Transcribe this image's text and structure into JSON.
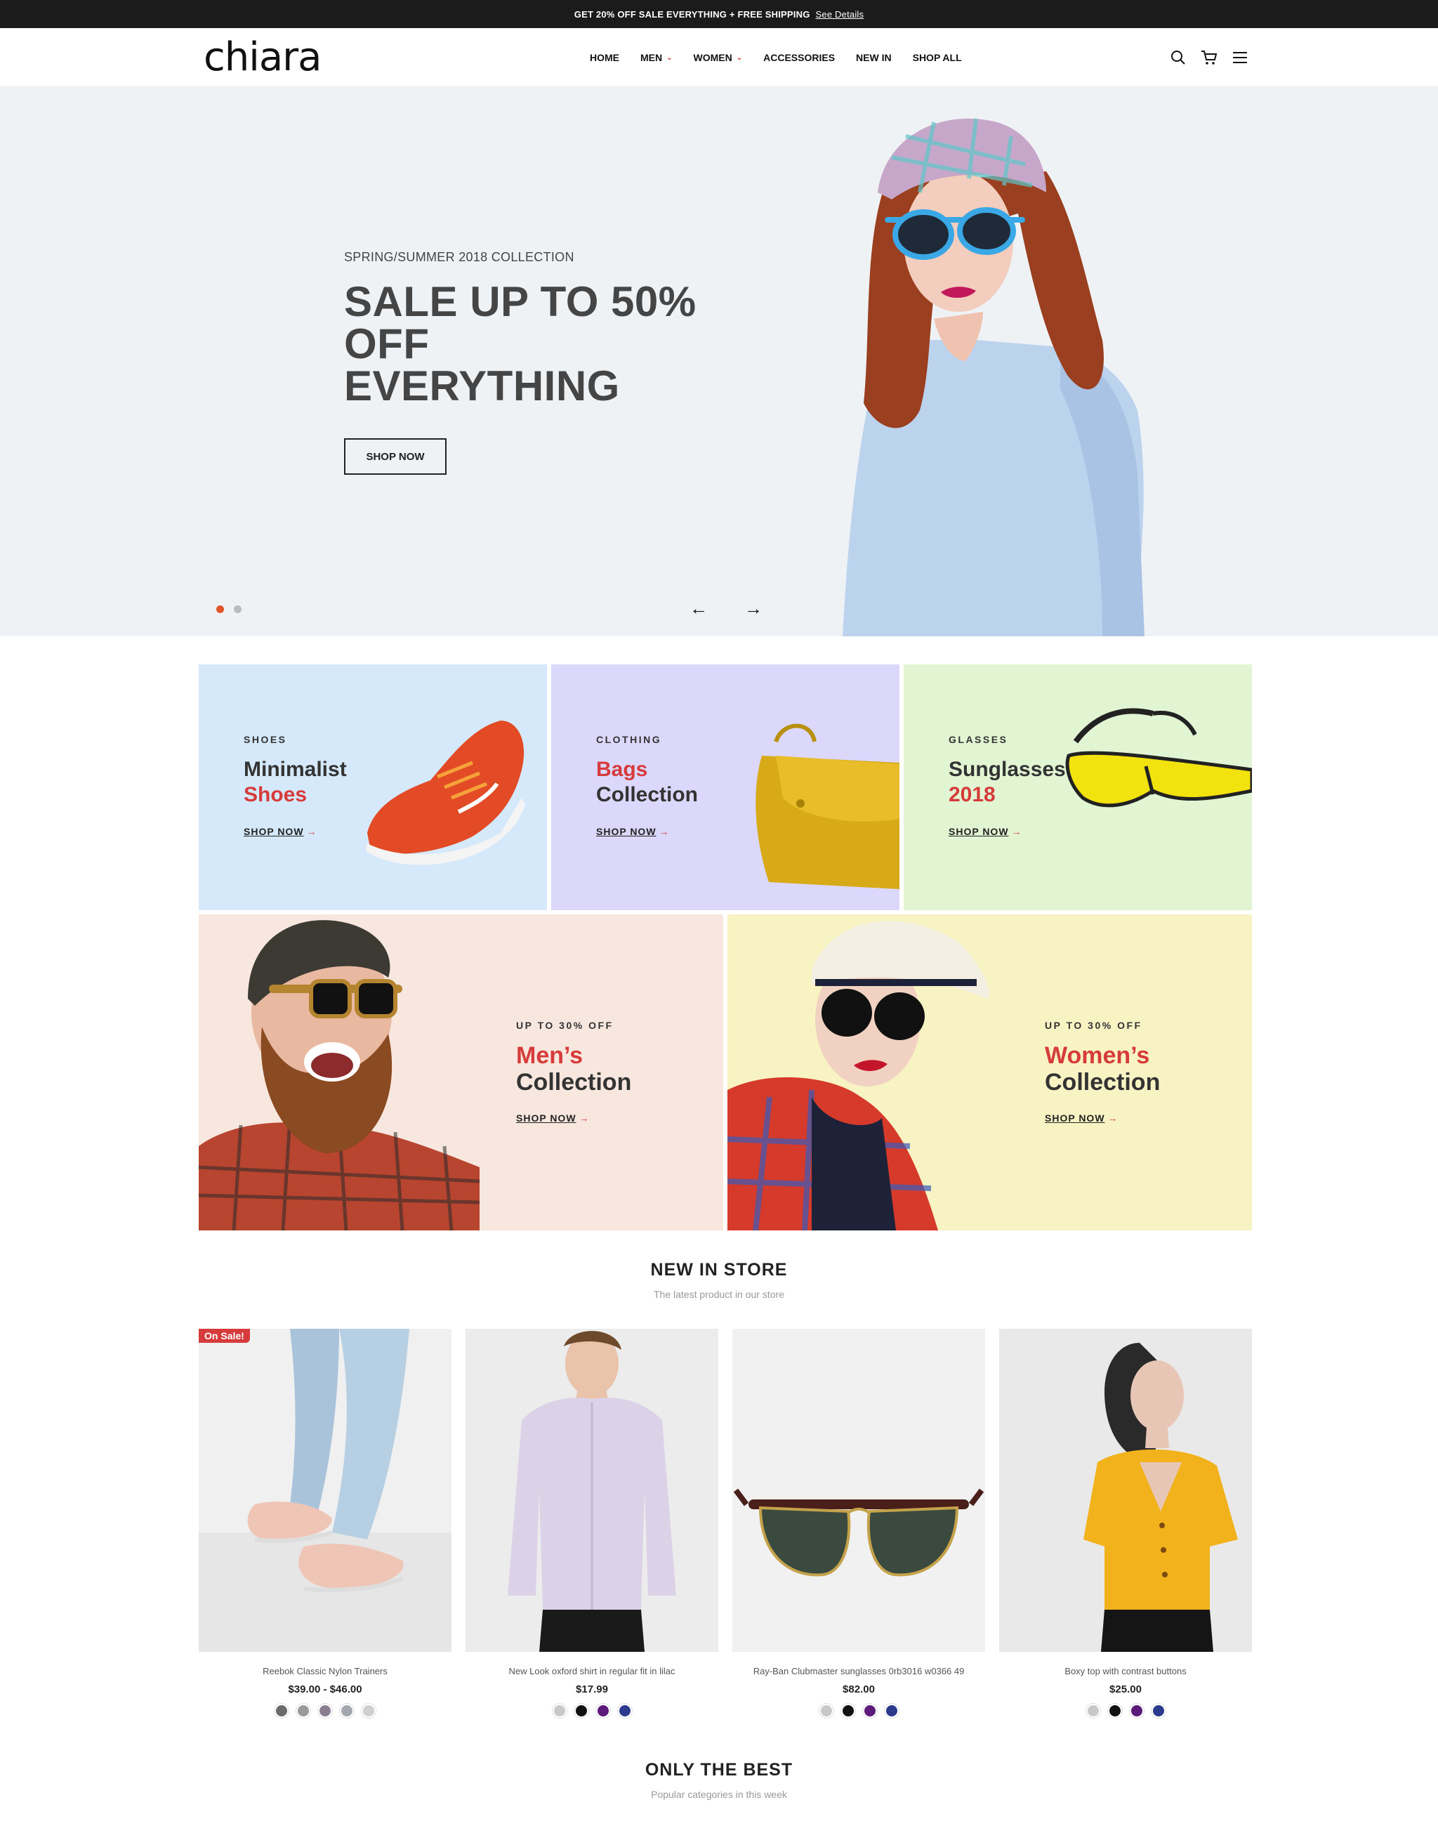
{
  "announcement": {
    "text": "GET 20% OFF SALE EVERYTHING + FREE SHIPPING",
    "link": "See Details"
  },
  "header": {
    "logo": "chiara",
    "nav": [
      {
        "label": "HOME",
        "dropdown": false
      },
      {
        "label": "MEN",
        "dropdown": true
      },
      {
        "label": "WOMEN",
        "dropdown": true
      },
      {
        "label": "ACCESSORIES",
        "dropdown": false
      },
      {
        "label": "NEW IN",
        "dropdown": false
      },
      {
        "label": "SHOP ALL",
        "dropdown": false
      }
    ],
    "icons": [
      "search-icon",
      "cart-icon",
      "menu-icon"
    ]
  },
  "hero": {
    "subtitle": "SPRING/SUMMER 2018 COLLECTION",
    "title_lines": [
      "SALE UP TO 50%",
      "OFF",
      "EVERYTHING"
    ],
    "button": "SHOP NOW",
    "slides": 2,
    "active_slide": 1,
    "accent": "#e0562a"
  },
  "tiles": {
    "shoes": {
      "tag": "SHOES",
      "line1": "Minimalist",
      "line2": "Shoes",
      "cta": "SHOP NOW",
      "bg": "#d5e9fb"
    },
    "bags": {
      "tag": "CLOTHING",
      "line1": "Bags",
      "line2": "Collection",
      "cta": "SHOP NOW",
      "bg": "#dcd8fb"
    },
    "glasses": {
      "tag": "GLASSES",
      "line1": "Sunglasses",
      "line2": "2018",
      "cta": "SHOP NOW",
      "bg": "#e2f5d3"
    },
    "men": {
      "tag": "UP TO 30% OFF",
      "line1": "Men’s",
      "line2": "Collection",
      "cta": "SHOP NOW",
      "bg": "#f7e7de"
    },
    "women": {
      "tag": "UP TO 30% OFF",
      "line1": "Women’s",
      "line2": "Collection",
      "cta": "SHOP NOW",
      "bg": "#f8f3c3"
    }
  },
  "new_in_store": {
    "title": "NEW IN STORE",
    "subtitle": "The latest product in our store",
    "products": [
      {
        "name": "Reebok Classic Nylon Trainers",
        "price": "$39.00 - $46.00",
        "badge": "On Sale!",
        "swatches": [
          "#6b6b6b",
          "#9a9a9a",
          "#8a7f90",
          "#a3a8b0",
          "#cfcfcf"
        ]
      },
      {
        "name": "New Look oxford shirt in regular fit in lilac",
        "price": "$17.99",
        "swatches": [
          "#c8c8c8",
          "#111111",
          "#5c1a7a",
          "#2b3a8c"
        ]
      },
      {
        "name": "Ray-Ban Clubmaster sunglasses 0rb3016 w0366 49",
        "price": "$82.00",
        "swatches": [
          "#c8c8c8",
          "#111111",
          "#5c1a7a",
          "#2b3a8c"
        ]
      },
      {
        "name": "Boxy top with contrast buttons",
        "price": "$25.00",
        "swatches": [
          "#c8c8c8",
          "#111111",
          "#5c1a7a",
          "#2b3a8c"
        ]
      }
    ]
  },
  "only_the_best": {
    "title": "ONLY THE BEST",
    "subtitle": "Popular categories in this week"
  }
}
